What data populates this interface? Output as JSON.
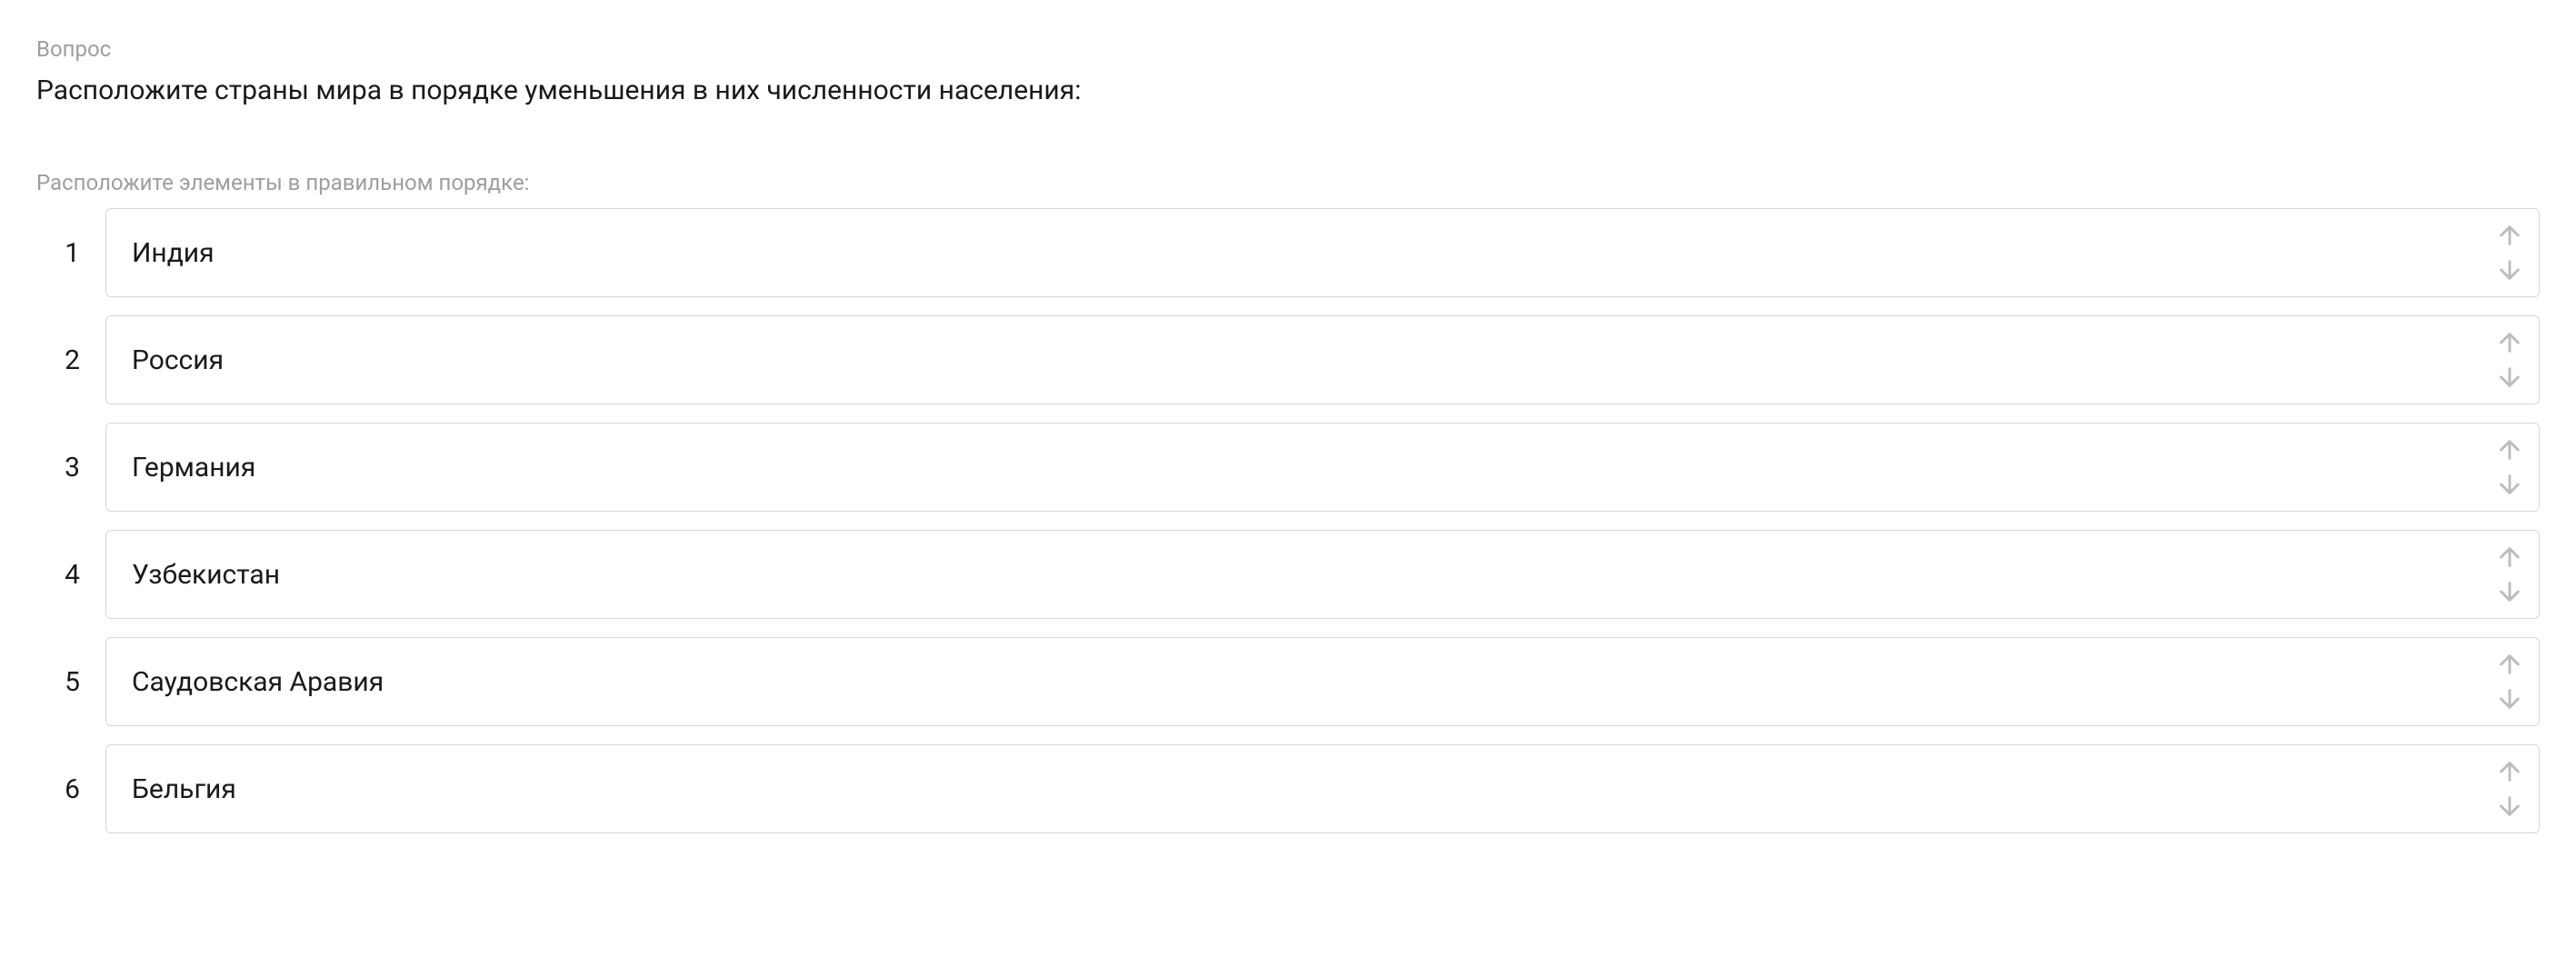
{
  "question_label": "Вопрос",
  "question_text": "Расположите страны мира в порядке уменьшения в них численности населения:",
  "instruction": "Расположите элементы в правильном порядке:",
  "items": [
    {
      "number": "1",
      "label": "Индия"
    },
    {
      "number": "2",
      "label": "Россия"
    },
    {
      "number": "3",
      "label": "Германия"
    },
    {
      "number": "4",
      "label": "Узбекистан"
    },
    {
      "number": "5",
      "label": "Саудовская Аравия"
    },
    {
      "number": "6",
      "label": "Бельгия"
    }
  ]
}
